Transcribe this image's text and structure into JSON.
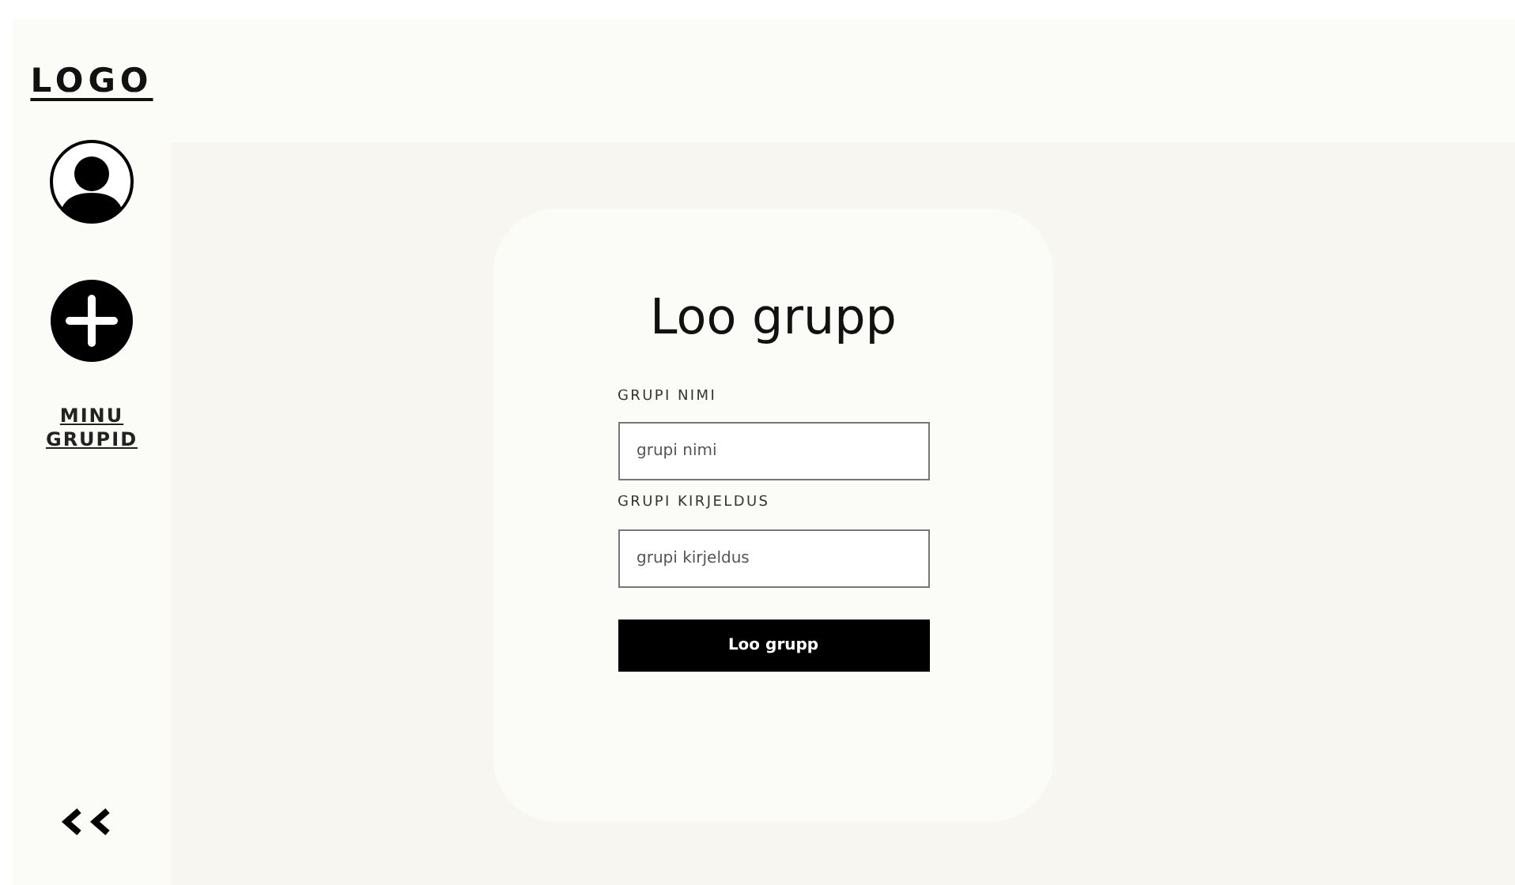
{
  "logo": "LOGO",
  "sidebar": {
    "items": [
      {
        "kind": "profile"
      },
      {
        "kind": "add"
      },
      {
        "kind": "text",
        "label": "MINU GRUPID"
      }
    ]
  },
  "form": {
    "title": "Loo grupp",
    "fields": [
      {
        "label": "GRUPI NIMI",
        "placeholder": "grupi nimi"
      },
      {
        "label": "GRUPI KIRJELDUS",
        "placeholder": "grupi kirjeldus"
      }
    ],
    "submit": "Loo grupp"
  }
}
